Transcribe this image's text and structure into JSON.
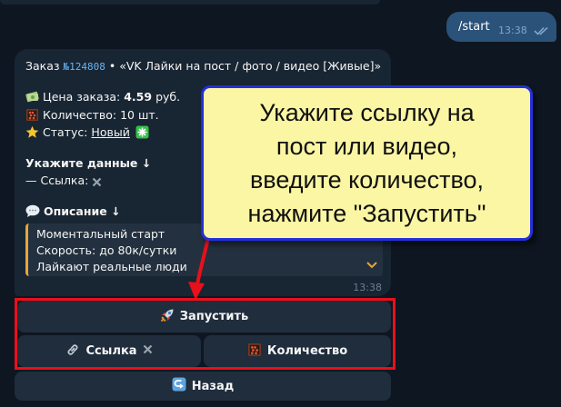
{
  "outgoing": {
    "text": "/start",
    "time": "13:38"
  },
  "order": {
    "prefix": "Заказ",
    "number": "№124808",
    "title": "• «VK Лайки на пост / фото / видео [Живые]»",
    "price_label": "Цена заказа:",
    "price_value": "4.59",
    "price_unit": "руб.",
    "quantity": "Количество: 10 шт.",
    "status_label": "Статус:",
    "status_value": "Новый",
    "enter_data": "Укажите данные ↓",
    "link_line": "— Ссылка:",
    "description_title": "Описание ↓",
    "description": [
      "Моментальный старт",
      "Скорость: до 80к/сутки",
      "Лайкают реальные люди"
    ],
    "time": "13:38"
  },
  "buttons": {
    "start": "Запустить",
    "link": "Ссылка",
    "quantity": "Количество",
    "back": "Назад"
  },
  "callout": {
    "lines": [
      "Укажите ссылку на",
      "пост или видео,",
      "введите количество,",
      "нажмите \"Запустить\""
    ]
  },
  "colors": {
    "background": "#0e1621",
    "incoming_bubble": "#182533",
    "outgoing_bubble": "#2b5278",
    "button": "#1f2d3d",
    "callout_bg": "#fbf6a3",
    "callout_border": "#2430d8",
    "highlight": "#e8101a",
    "quote_accent": "#e8a53b"
  },
  "icons": [
    "double-check-icon",
    "money-icon",
    "abacus-icon",
    "star-icon",
    "sparkle-icon",
    "cross-icon",
    "speech-bubble-icon",
    "chevron-down-icon",
    "rocket-icon",
    "link-icon",
    "back-arrow-icon"
  ]
}
